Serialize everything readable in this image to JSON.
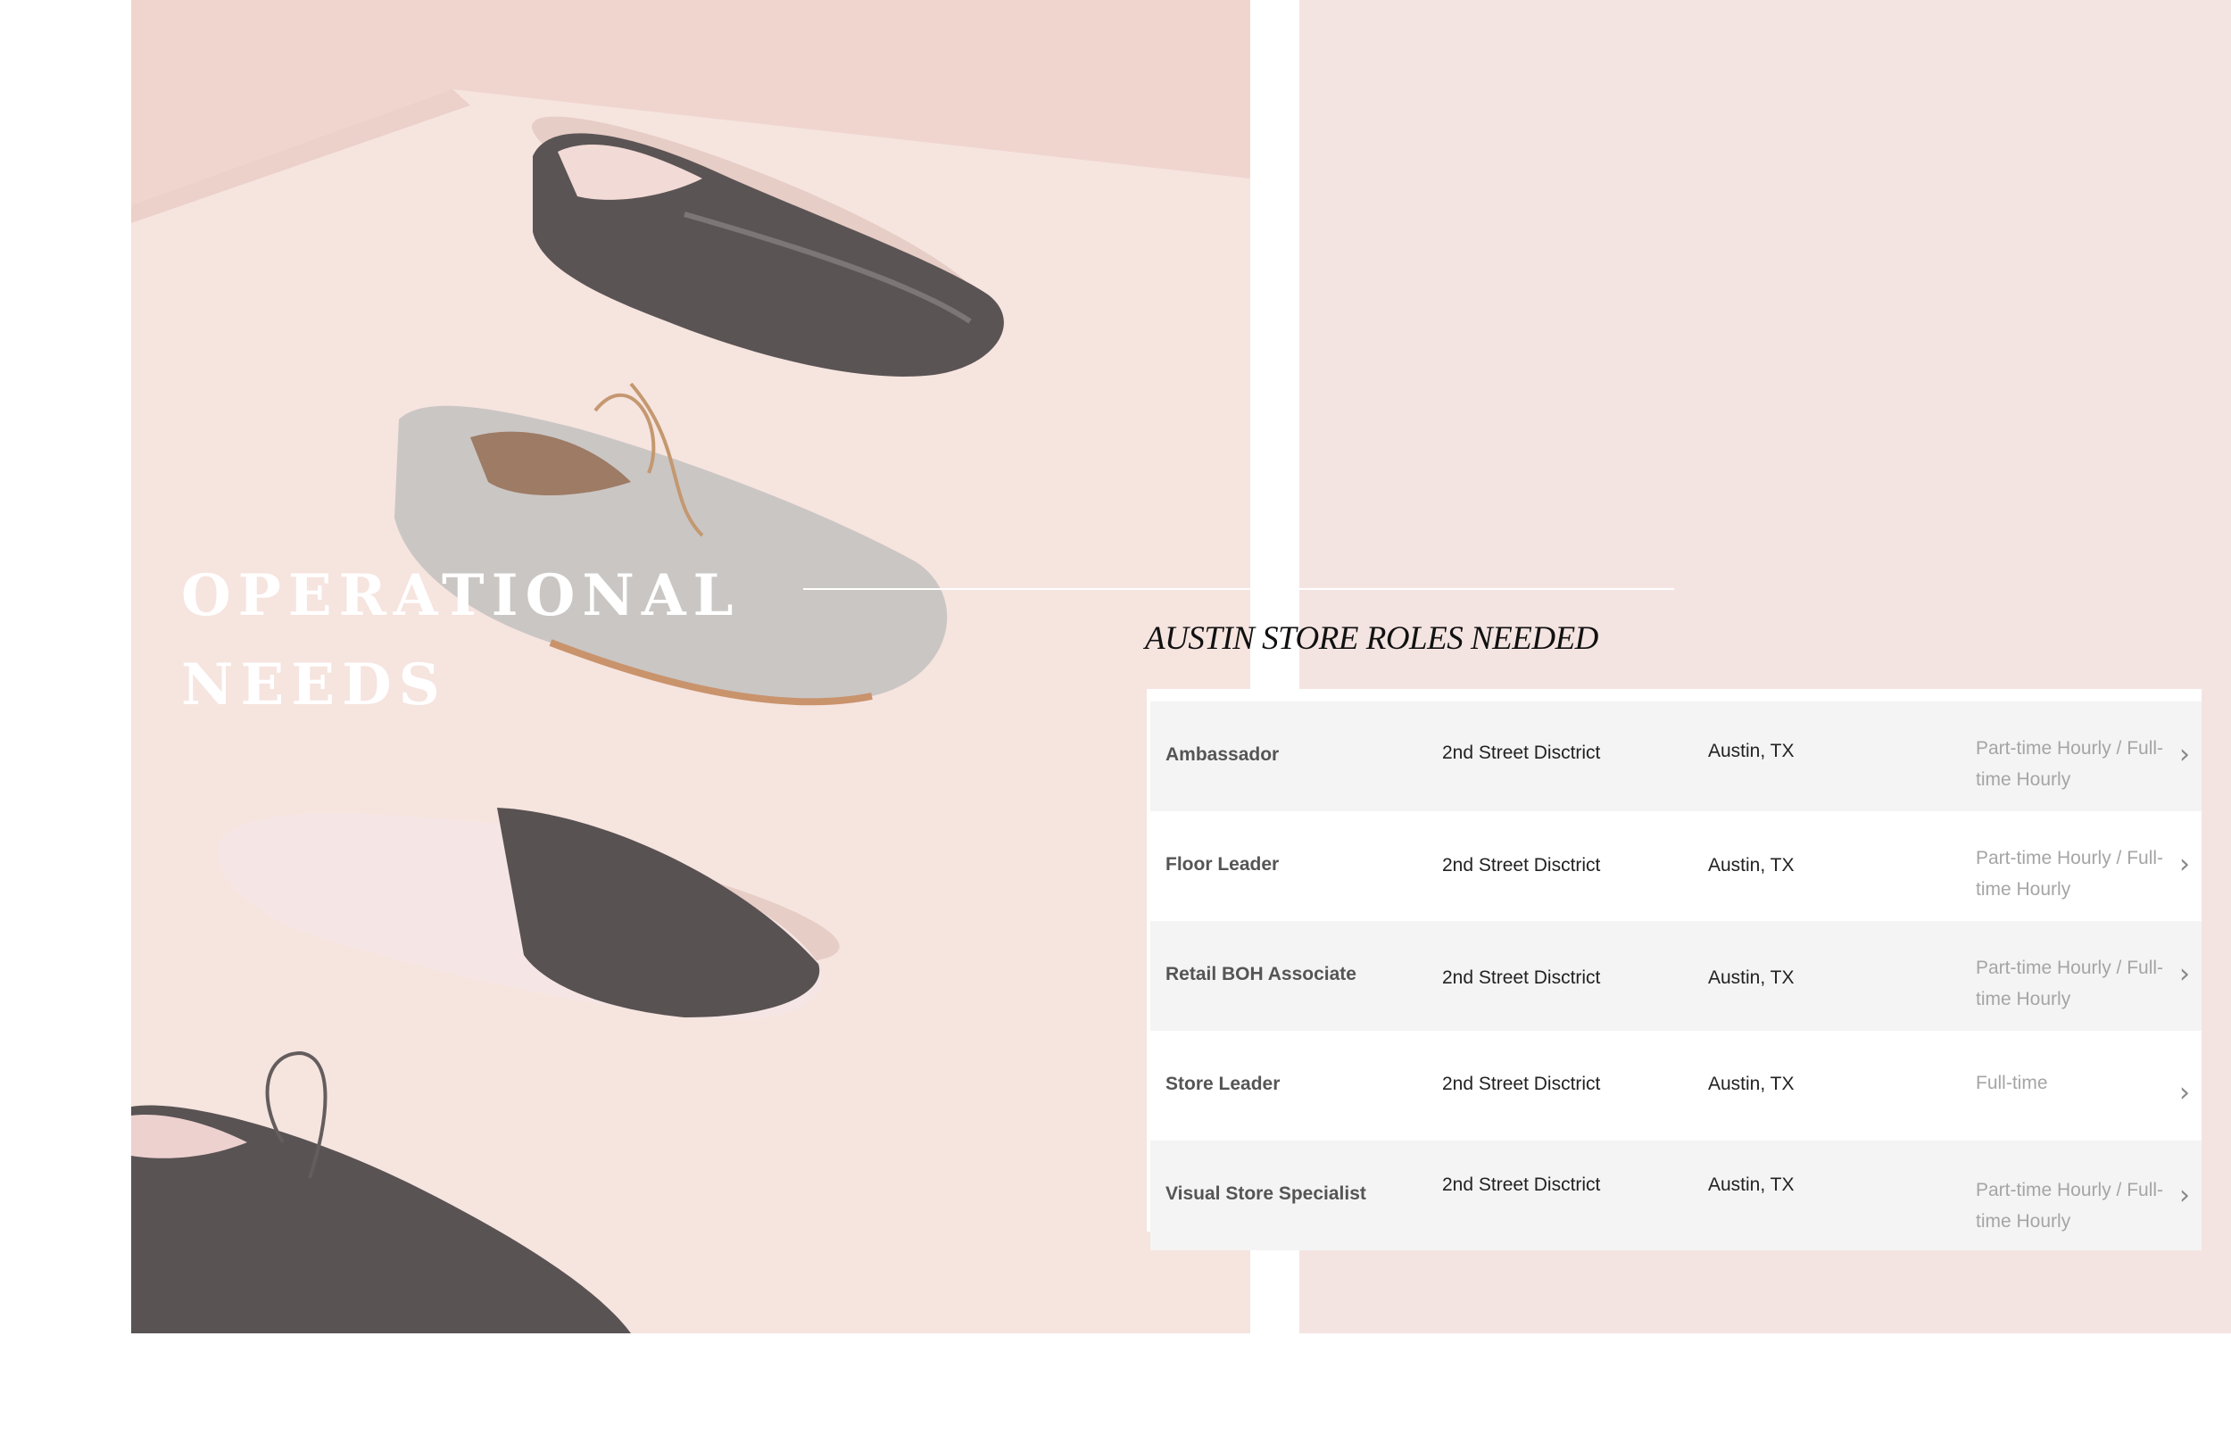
{
  "headline": {
    "line1": "OPERATIONAL",
    "line2": "NEEDS"
  },
  "subhead": "AUSTIN STORE ROLES NEEDED",
  "roles": [
    {
      "title": "Ambassador",
      "district": "2nd Street Disctrict",
      "city": "Austin, TX",
      "type": "Part-time Hourly / Full-time Hourly"
    },
    {
      "title": "Floor Leader",
      "district": "2nd Street Disctrict",
      "city": "Austin, TX",
      "type": "Part-time Hourly / Full-time Hourly"
    },
    {
      "title": "Retail BOH Associate",
      "district": "2nd Street Disctrict",
      "city": "Austin, TX",
      "type": "Part-time Hourly / Full-time Hourly"
    },
    {
      "title": "Store Leader",
      "district": "2nd Street Disctrict",
      "city": "Austin, TX",
      "type": "Full-time"
    },
    {
      "title": "Visual Store Specialist",
      "district": "2nd Street Disctrict",
      "city": "Austin, TX",
      "type": "Part-time Hourly / Full-time Hourly"
    }
  ],
  "icons": {
    "row_arrow": "chevron-right-icon"
  },
  "colors": {
    "panel_pink": "#f4e4e1",
    "headline": "#ffffff",
    "row_shade": "#f4f4f4"
  }
}
